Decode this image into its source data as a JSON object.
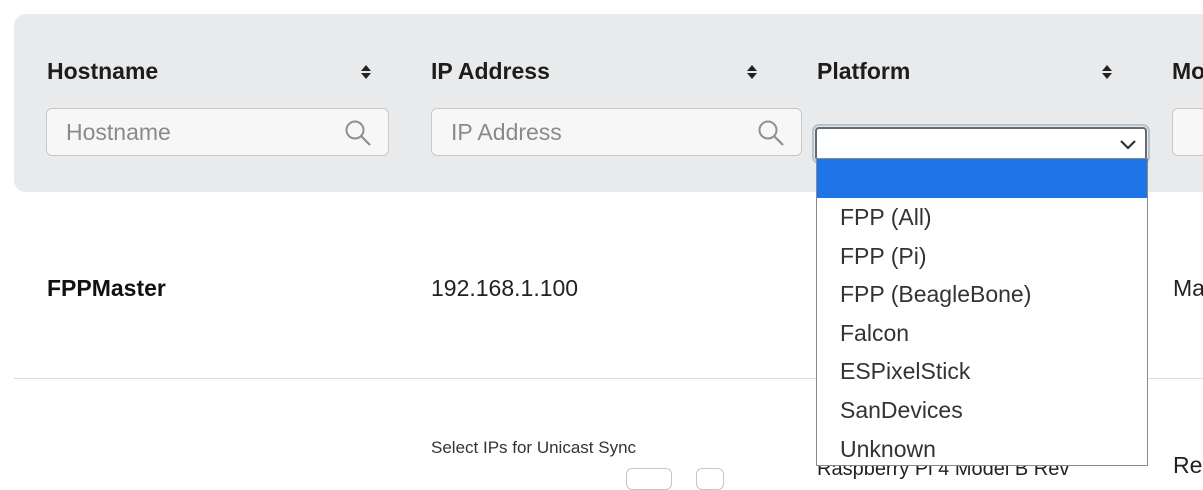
{
  "columns": {
    "hostname": {
      "title": "Hostname",
      "placeholder": "Hostname"
    },
    "ip_address": {
      "title": "IP Address",
      "placeholder": "IP Address"
    },
    "platform": {
      "title": "Platform",
      "selected": ""
    },
    "mode": {
      "title": "Mo"
    }
  },
  "platform_options": [
    "",
    "FPP (All)",
    "FPP (Pi)",
    "FPP (BeagleBone)",
    "Falcon",
    "ESPixelStick",
    "SanDevices",
    "Unknown"
  ],
  "rows": [
    {
      "hostname": "FPPMaster",
      "ip": "192.168.1.100",
      "mode": "Ma"
    },
    {
      "ip_note": "Select IPs for Unicast Sync",
      "platform": "Raspberry Pi 4 Model B Rev",
      "mode": "Re"
    }
  ],
  "icons": {
    "sort": "sort-updown-icon",
    "search": "search-icon",
    "dropdown": "chevron-down-icon"
  },
  "colors": {
    "header_bg": "#e9eaeb",
    "selected_option": "#1f74e8"
  }
}
